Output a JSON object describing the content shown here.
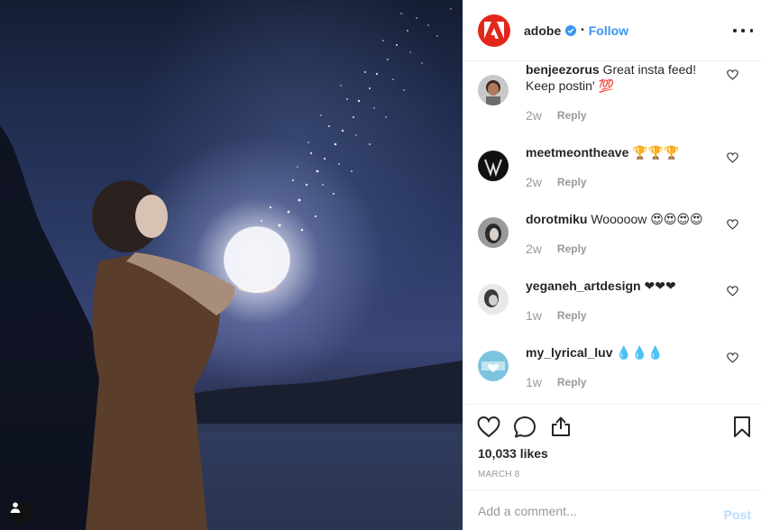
{
  "post": {
    "username": "adobe",
    "follow_label": "Follow",
    "separator": "•",
    "likes": "10,033 likes",
    "date": "MARCH 8"
  },
  "comments": [
    {
      "username": "benjeezorus",
      "text": " Great insta feed! Keep postin' 💯",
      "age": "2w",
      "reply": "Reply"
    },
    {
      "username": "meetmeontheave",
      "text": " 🏆🏆🏆",
      "age": "2w",
      "reply": "Reply"
    },
    {
      "username": "dorotmiku",
      "text": " Wooooow 😍😍😍😍",
      "age": "2w",
      "reply": "Reply"
    },
    {
      "username": "yeganeh_artdesign",
      "text": " ❤❤❤",
      "age": "1w",
      "reply": "Reply"
    },
    {
      "username": "my_lyrical_luv",
      "text": " 💧💧💧",
      "age": "1w",
      "reply": "Reply"
    }
  ],
  "add_comment": {
    "placeholder": "Add a comment...",
    "post_label": "Post"
  },
  "colors": {
    "brand": "#e5261a",
    "link": "#3897f0",
    "post_disabled": "#b9dcfb",
    "muted": "#999999"
  }
}
